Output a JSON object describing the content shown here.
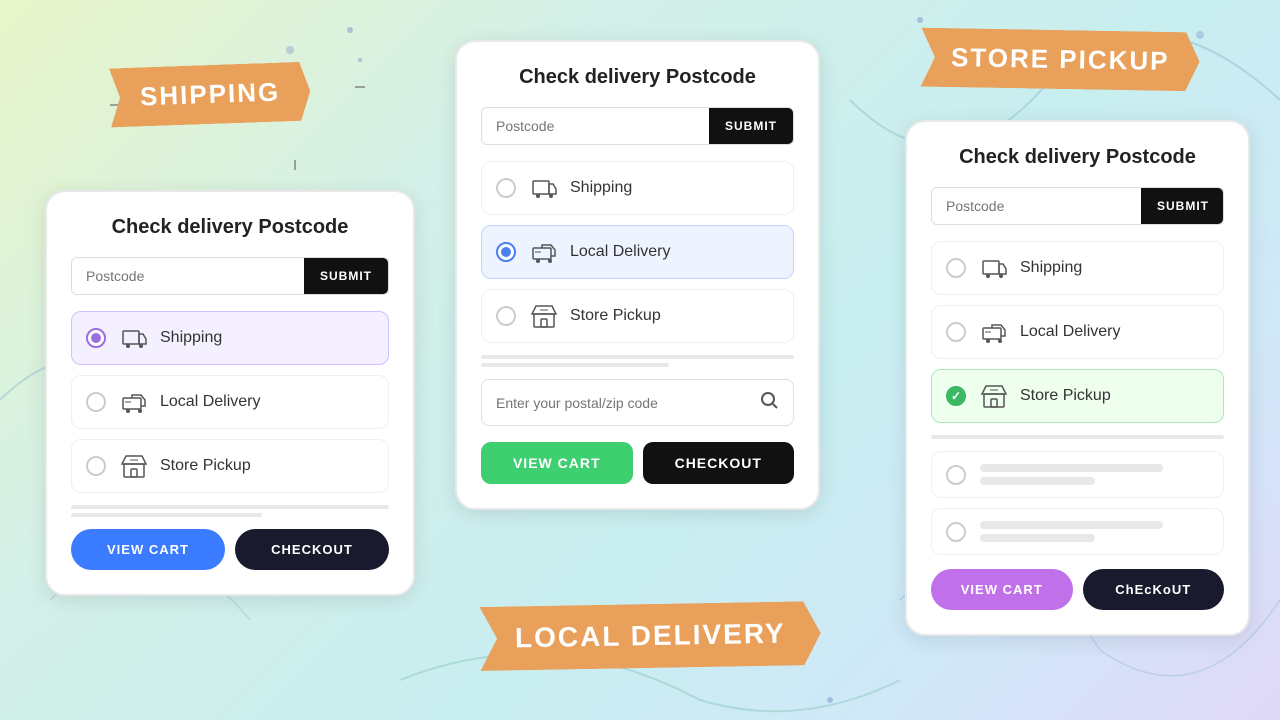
{
  "background": {
    "color_start": "#e8f5c8",
    "color_end": "#e0d8f8"
  },
  "labels": {
    "shipping": "SHIPPING",
    "local_delivery": "LOCAL DELIVERY",
    "store_pickup": "STORE PICKUP"
  },
  "card_left": {
    "title": "Check delivery Postcode",
    "postcode_placeholder": "Postcode",
    "submit_label": "SUBMIT",
    "options": [
      {
        "id": "shipping",
        "label": "Shipping",
        "selected": true,
        "style": "purple"
      },
      {
        "id": "local_delivery",
        "label": "Local Delivery",
        "selected": false,
        "style": "none"
      },
      {
        "id": "store_pickup",
        "label": "Store Pickup",
        "selected": false,
        "style": "none"
      }
    ],
    "view_cart_label": "VIEW CART",
    "checkout_label": "CHECKOUT"
  },
  "card_center": {
    "title": "Check delivery Postcode",
    "postcode_placeholder": "Postcode",
    "submit_label": "SUBMIT",
    "options": [
      {
        "id": "shipping",
        "label": "Shipping",
        "selected": false,
        "style": "none"
      },
      {
        "id": "local_delivery",
        "label": "Local Delivery",
        "selected": true,
        "style": "blue"
      },
      {
        "id": "store_pickup",
        "label": "Store Pickup",
        "selected": false,
        "style": "none"
      }
    ],
    "search_placeholder": "Enter your postal/zip code",
    "view_cart_label": "VIEW CART",
    "checkout_label": "CHECKOUT"
  },
  "card_right": {
    "title": "Check delivery Postcode",
    "postcode_placeholder": "Postcode",
    "submit_label": "SUBMIT",
    "options": [
      {
        "id": "shipping",
        "label": "Shipping",
        "selected": false,
        "style": "none"
      },
      {
        "id": "local_delivery",
        "label": "Local Delivery",
        "selected": false,
        "style": "none"
      },
      {
        "id": "store_pickup",
        "label": "Store Pickup",
        "selected": true,
        "style": "green"
      }
    ],
    "view_cart_label": "VIEW CART",
    "checkout_label": "ChEcKoUT"
  }
}
